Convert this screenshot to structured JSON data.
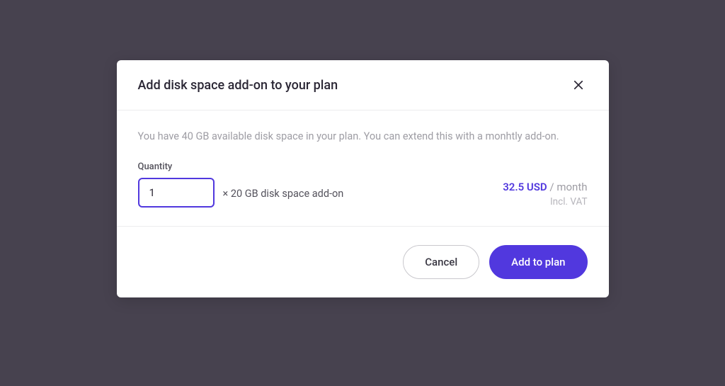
{
  "modal": {
    "title": "Add disk space add-on to your plan",
    "description": "You have 40 GB available disk space in your plan. You can extend this with a monhtly add-on.",
    "quantity_label": "Quantity",
    "quantity_value": "1",
    "addon_unit_label": "× 20 GB disk space add-on",
    "price_amount": "32.5 USD",
    "price_period": " / month",
    "vat_note": "Incl. VAT",
    "cancel_label": "Cancel",
    "submit_label": "Add to plan"
  },
  "colors": {
    "accent": "#5138de",
    "backdrop": "#47424f"
  }
}
